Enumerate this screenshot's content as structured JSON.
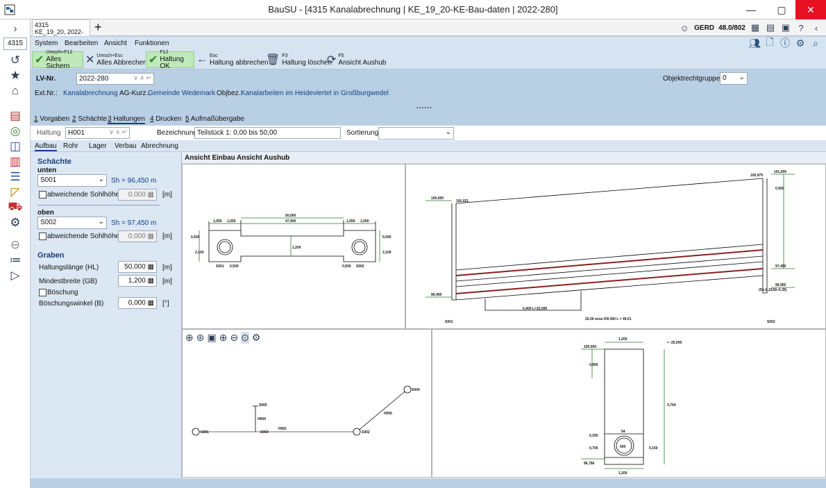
{
  "window": {
    "title": "BauSU - [4315 Kanalabrechnung | KE_19_20-KE-Bau-daten | 2022-280]",
    "controls": [
      "—",
      "▢",
      "✕"
    ]
  },
  "left_nav": {
    "expand_glyph": "›",
    "project_number": "4315"
  },
  "doc_tab": {
    "line1": "4315",
    "line2": "KE_19_20, 2022-280",
    "add": "+"
  },
  "status_right": {
    "user": "GERD",
    "version": "48.0/802"
  },
  "menu": {
    "items": [
      "System",
      "Bearbeiten",
      "Ansicht",
      "Funktionen"
    ]
  },
  "toolbar": {
    "buttons": [
      {
        "key": "Umsch+F12",
        "label": "Alles Sichern",
        "icon": "check-icon"
      },
      {
        "key": "Umsch+Esc",
        "label": "Alles Abbrechen",
        "icon": "x-icon"
      },
      {
        "key": "F12",
        "label": "Haltung OK",
        "icon": "check-icon"
      },
      {
        "key": "Esc",
        "label": "Haltung abbrechen",
        "icon": "arrow-left-icon"
      },
      {
        "key": "F3",
        "label": "Haltung löschen",
        "icon": "trash-icon"
      },
      {
        "key": "F5",
        "label": "Ansicht Aushub",
        "icon": "refresh-icon"
      }
    ]
  },
  "header": {
    "lv_label": "LV-Nr.",
    "lv_value": "2022-280",
    "objekt_label": "Objektrechtgruppe",
    "objekt_value": "0",
    "ext_label": "Ext.Nr.:",
    "ext_value": "Kanalabrechnung",
    "ag_label": "AG-Kurz.:",
    "ag_value": "Gemeinde Wedemark",
    "objbez_label": "Objbez.:",
    "objbez_value": "Kanalarbeiten im Heideviertel in Großburgwedel",
    "dots": "......"
  },
  "tabs": [
    {
      "num": "1",
      "label": "Vorgaben"
    },
    {
      "num": "2",
      "label": "Schächte"
    },
    {
      "num": "3",
      "label": "Haltungen"
    },
    {
      "num": "4",
      "label": "Drucken"
    },
    {
      "num": "5",
      "label": "Aufmaßübergabe"
    }
  ],
  "haltung_row": {
    "haltung_label": "Haltung",
    "haltung_value": "H001",
    "bez_label": "Bezeichnung",
    "bez_value": "Teilstück 1:  0,00 bis 50,00",
    "sort_label": "Sortierung",
    "sort_value": ""
  },
  "sub_tabs": [
    "Aufbau",
    "Rohr",
    "Lager",
    "Verbau",
    "Abrechnung"
  ],
  "form": {
    "schaechte": "Schächte",
    "unten": "unten",
    "unten_value": "S001",
    "unten_sh": "Sh = 96,450 m",
    "abw_label": "abweichende Sohlhöhe",
    "abw1_value": "0,000",
    "oben": "oben",
    "oben_value": "S002",
    "oben_sh": "Sh = 97,450 m",
    "abw2_value": "0,000",
    "unit_m": "[m]",
    "graben": "Graben",
    "hl_label": "Haltungslänge (HL)",
    "hl_value": "50,000",
    "gb_label": "Mindestbreite (GB)",
    "gb_value": "1,200",
    "boeschung_label": "Böschung",
    "bw_label": "Böschungswinkel (B)",
    "bw_value": "0,000",
    "unit_deg": "[°]"
  },
  "views": {
    "tabs": [
      "Ansicht Einbau",
      "Ansicht Aushub"
    ],
    "plan": {
      "dim_top1": "1,050",
      "dim_top2": "1,050",
      "dim_top3": "47,900",
      "dim_top4": "1,050",
      "dim_top5": "1,050",
      "dim_total": "50,000",
      "dim_w": "1,200",
      "left_h1": "0,500",
      "left_h2": "2,100",
      "right_h1": "0,500",
      "right_h2": "2,100",
      "s_left": "S001",
      "s_left_dim": "0,500",
      "s_right": "S002",
      "s_right_dim": "0,500"
    },
    "section": {
      "lv_left": "100,000",
      "lv_left2": "100,021",
      "lv_right_top": "100,979",
      "lv_right2": "101,000",
      "lv_right_h": "0,950",
      "lv_right_mid": "97,450",
      "lv_left_bot": "96,450",
      "lv_right_bot": "96,950",
      "lv_right_bot2": "(Sh-0,15/Sh-0,35)",
      "bottom_lbl": "0,400 L=15,000",
      "s_left": "S001",
      "s_mid": "20,00 m/ue DN 500 L = 49,01",
      "s_right": "S002"
    },
    "network": {
      "nodes": [
        "S001",
        "S002",
        "S003",
        "S004",
        "S005",
        "H001",
        "H004",
        "H005"
      ]
    },
    "cross": {
      "top_w": "1,200",
      "ref": "= -25,000",
      "top_lv": "100,500",
      "h1": "0,950",
      "h2": "3,704",
      "pipe": "DN",
      "pipe_label": "500",
      "dim_a": "0,250",
      "dim_b": "0,700",
      "dim_c": "0,150",
      "bot_lv": "96,796",
      "bot_w": "1,200",
      "top_marker": "54"
    }
  },
  "zoom_tools": [
    "zoom-plus-icon",
    "zoom-fit-icon",
    "frame-icon",
    "zoom-in-icon",
    "zoom-out-icon",
    "zoom-window-icon",
    "settings-icon"
  ]
}
